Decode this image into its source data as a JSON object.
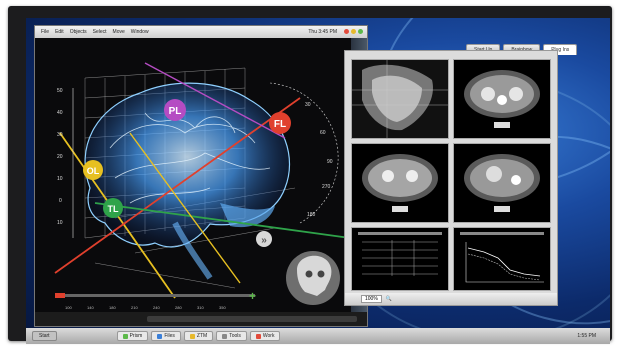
{
  "app": {
    "menu": [
      "File",
      "Edit",
      "Objects",
      "Select",
      "Move",
      "Window"
    ],
    "clock": "Thu 3:45 PM"
  },
  "overlay": {
    "labels": [
      "PL",
      "FL",
      "OL",
      "TL"
    ],
    "ruler_ticks": [
      "50",
      "40",
      "30",
      "20",
      "10",
      "0",
      "10"
    ],
    "arc_ticks": [
      "30",
      "60",
      "90",
      "270",
      "180"
    ],
    "timeline_ticks": [
      "100",
      "140",
      "180",
      "210",
      "240",
      "280",
      "310",
      "350"
    ],
    "next_icon_glyph": "»",
    "plus_glyph": "+"
  },
  "viewer": {
    "tabs": [
      "Start Up",
      "Brainbow",
      "Plug Ins"
    ],
    "active_tab": 2,
    "zoom": "100%"
  },
  "taskbar": {
    "start": "Start",
    "items": [
      "Prism",
      "Files",
      "ZTM",
      "Tools",
      "Work"
    ],
    "clock": "1:55 PM"
  },
  "colors": {
    "pl": "#b54cc3",
    "fl": "#e0402d",
    "ol": "#e7c021",
    "tl": "#2fa34a",
    "brain": "#5fb3ff"
  }
}
